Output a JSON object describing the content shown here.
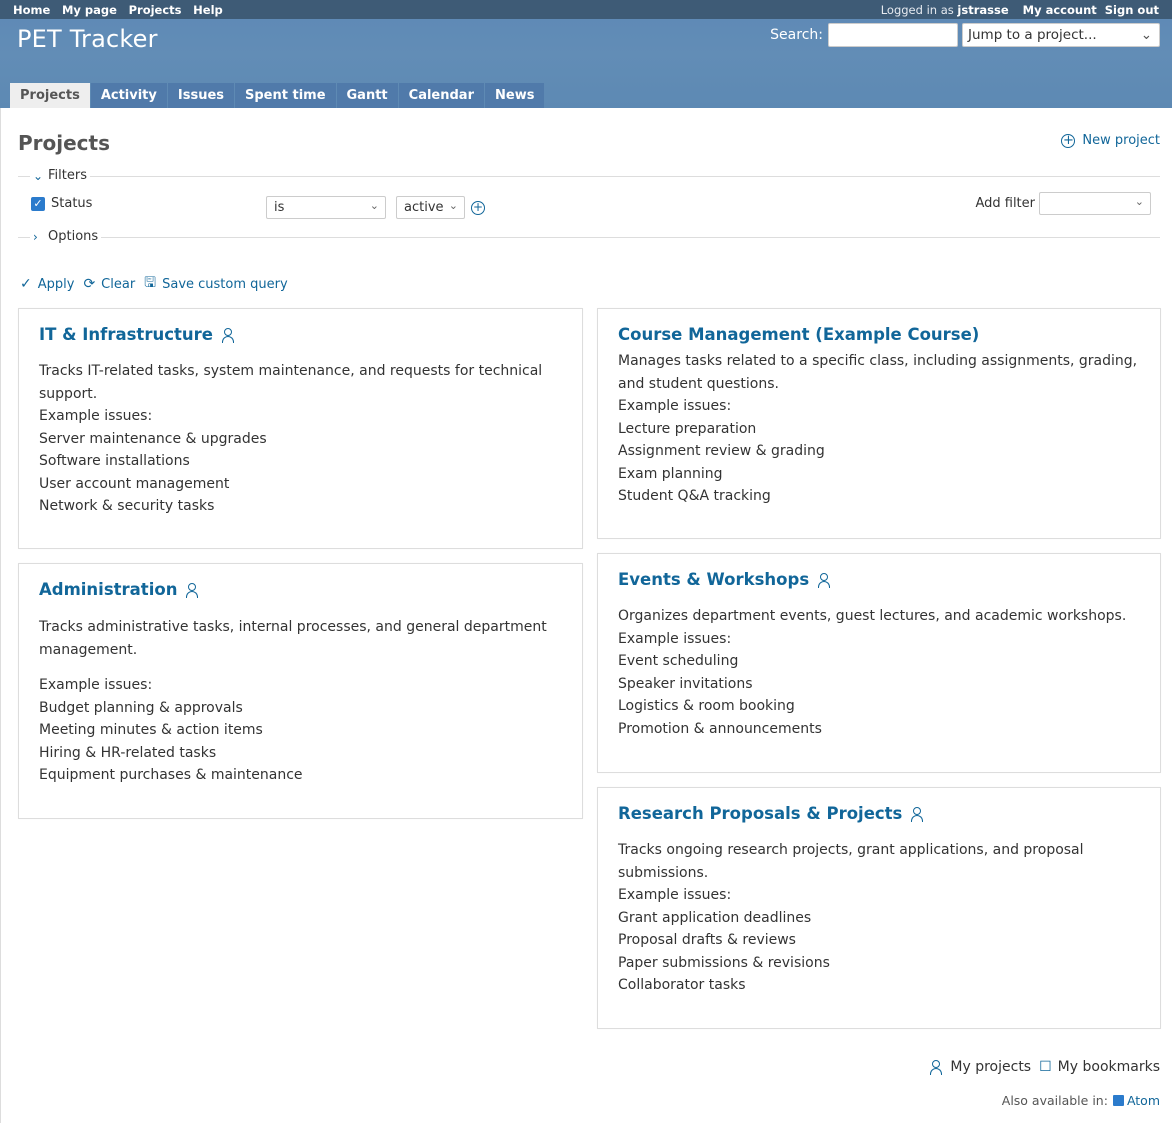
{
  "top_menu": {
    "links": [
      "Home",
      "My page",
      "Projects",
      "Help"
    ],
    "logged_in_prefix": "Logged in as",
    "username": "jstrasse",
    "my_account": "My account",
    "sign_out": "Sign out"
  },
  "header": {
    "title": "PET Tracker",
    "search_label": "Search:",
    "search_value": "",
    "jump_placeholder": "Jump to a project..."
  },
  "main_menu": {
    "tabs": [
      "Projects",
      "Activity",
      "Issues",
      "Spent time",
      "Gantt",
      "Calendar",
      "News"
    ],
    "selected": "Projects"
  },
  "page": {
    "title": "Projects",
    "new_project": "New project"
  },
  "filters": {
    "legend": "Filters",
    "status_label": "Status",
    "status_checked": true,
    "operator": "is",
    "value": "active",
    "add_filter_label": "Add filter",
    "add_filter_value": ""
  },
  "options": {
    "legend": "Options"
  },
  "buttons": {
    "apply": "Apply",
    "clear": "Clear",
    "save_query": "Save custom query"
  },
  "projects": [
    {
      "name": "IT & Infrastructure",
      "member": true,
      "description": "Tracks IT-related tasks, system maintenance, and requests for technical support.",
      "lines": [
        "Example issues:",
        "Server maintenance & upgrades",
        "Software installations",
        "User account management",
        "Network & security tasks"
      ]
    },
    {
      "name": "Course Management (Example Course)",
      "member": false,
      "description": "Manages tasks related to a specific class, including assignments, grading, and student questions.",
      "lines": [
        "Example issues:",
        "Lecture preparation",
        "Assignment review & grading",
        "Exam planning",
        "Student Q&A tracking"
      ]
    },
    {
      "name": "Administration",
      "member": true,
      "description": "Tracks administrative tasks, internal processes, and general department management.",
      "lines": [
        "Example issues:",
        "Budget planning & approvals",
        "Meeting minutes & action items",
        "Hiring & HR-related tasks",
        "Equipment purchases & maintenance"
      ]
    },
    {
      "name": "Events & Workshops",
      "member": true,
      "description": "Organizes department events, guest lectures, and academic workshops.",
      "lines": [
        "Example issues:",
        "Event scheduling",
        "Speaker invitations",
        "Logistics & room booking",
        "Promotion & announcements"
      ]
    },
    {
      "name": "Research Proposals & Projects",
      "member": true,
      "description": "Tracks ongoing research projects, grant applications, and proposal submissions.",
      "lines": [
        "Example issues:",
        "Grant application deadlines",
        "Proposal drafts & reviews",
        "Paper submissions & revisions",
        "Collaborator tasks"
      ]
    }
  ],
  "footer": {
    "my_projects": "My projects",
    "my_bookmarks": "My bookmarks",
    "also_available": "Also available in:",
    "atom": "Atom"
  }
}
